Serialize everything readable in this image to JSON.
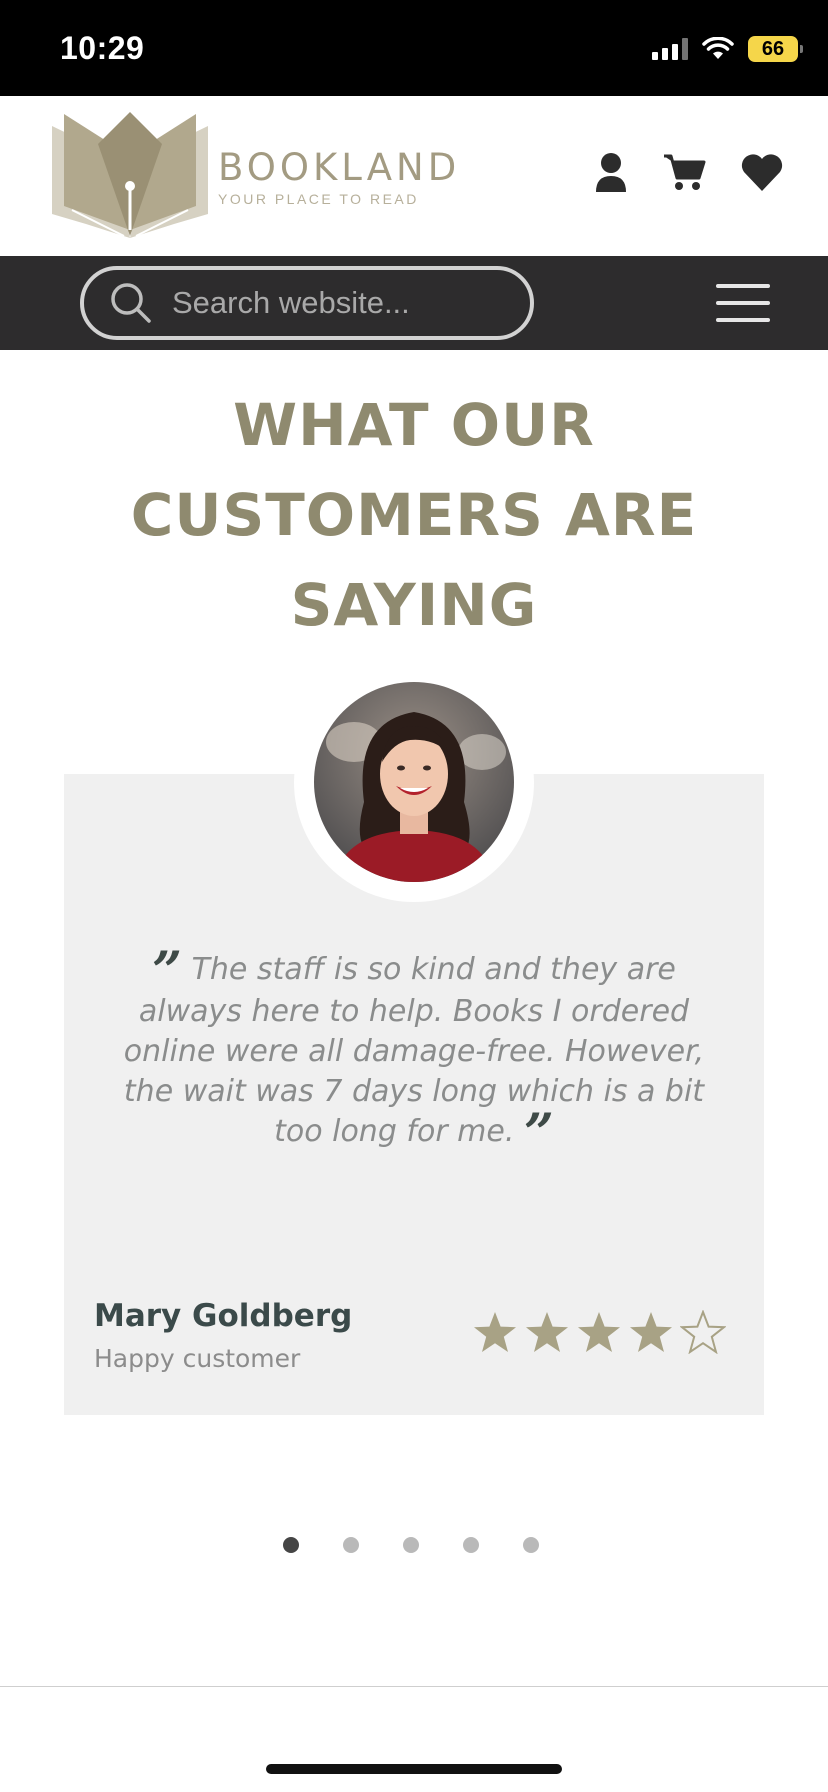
{
  "status_bar": {
    "time": "10:29",
    "battery": "66"
  },
  "brand": {
    "name": "BOOKLAND",
    "tagline": "YOUR PLACE TO READ"
  },
  "search": {
    "placeholder": "Search website..."
  },
  "section": {
    "title_lines": [
      "WHAT OUR",
      "CUSTOMERS ARE",
      "SAYING"
    ]
  },
  "testimonial": {
    "quote": "The staff is so kind and they are always here to help. Books I ordered online were all damage-free. However, the wait was 7 days long which is a bit too long for me.",
    "open_mark": "”",
    "close_mark": "”",
    "name": "Mary Goldberg",
    "role": "Happy customer",
    "rating": 4,
    "max_rating": 5
  },
  "carousel": {
    "total": 5,
    "active": 0
  },
  "colors": {
    "accent": "#8f8a6f",
    "star": "#a8a285",
    "dark_bar": "#2d2c2d",
    "card": "#f0f0f0"
  },
  "icons": [
    "search-icon",
    "user-icon",
    "cart-icon",
    "heart-icon",
    "menu-icon",
    "star-icon"
  ]
}
